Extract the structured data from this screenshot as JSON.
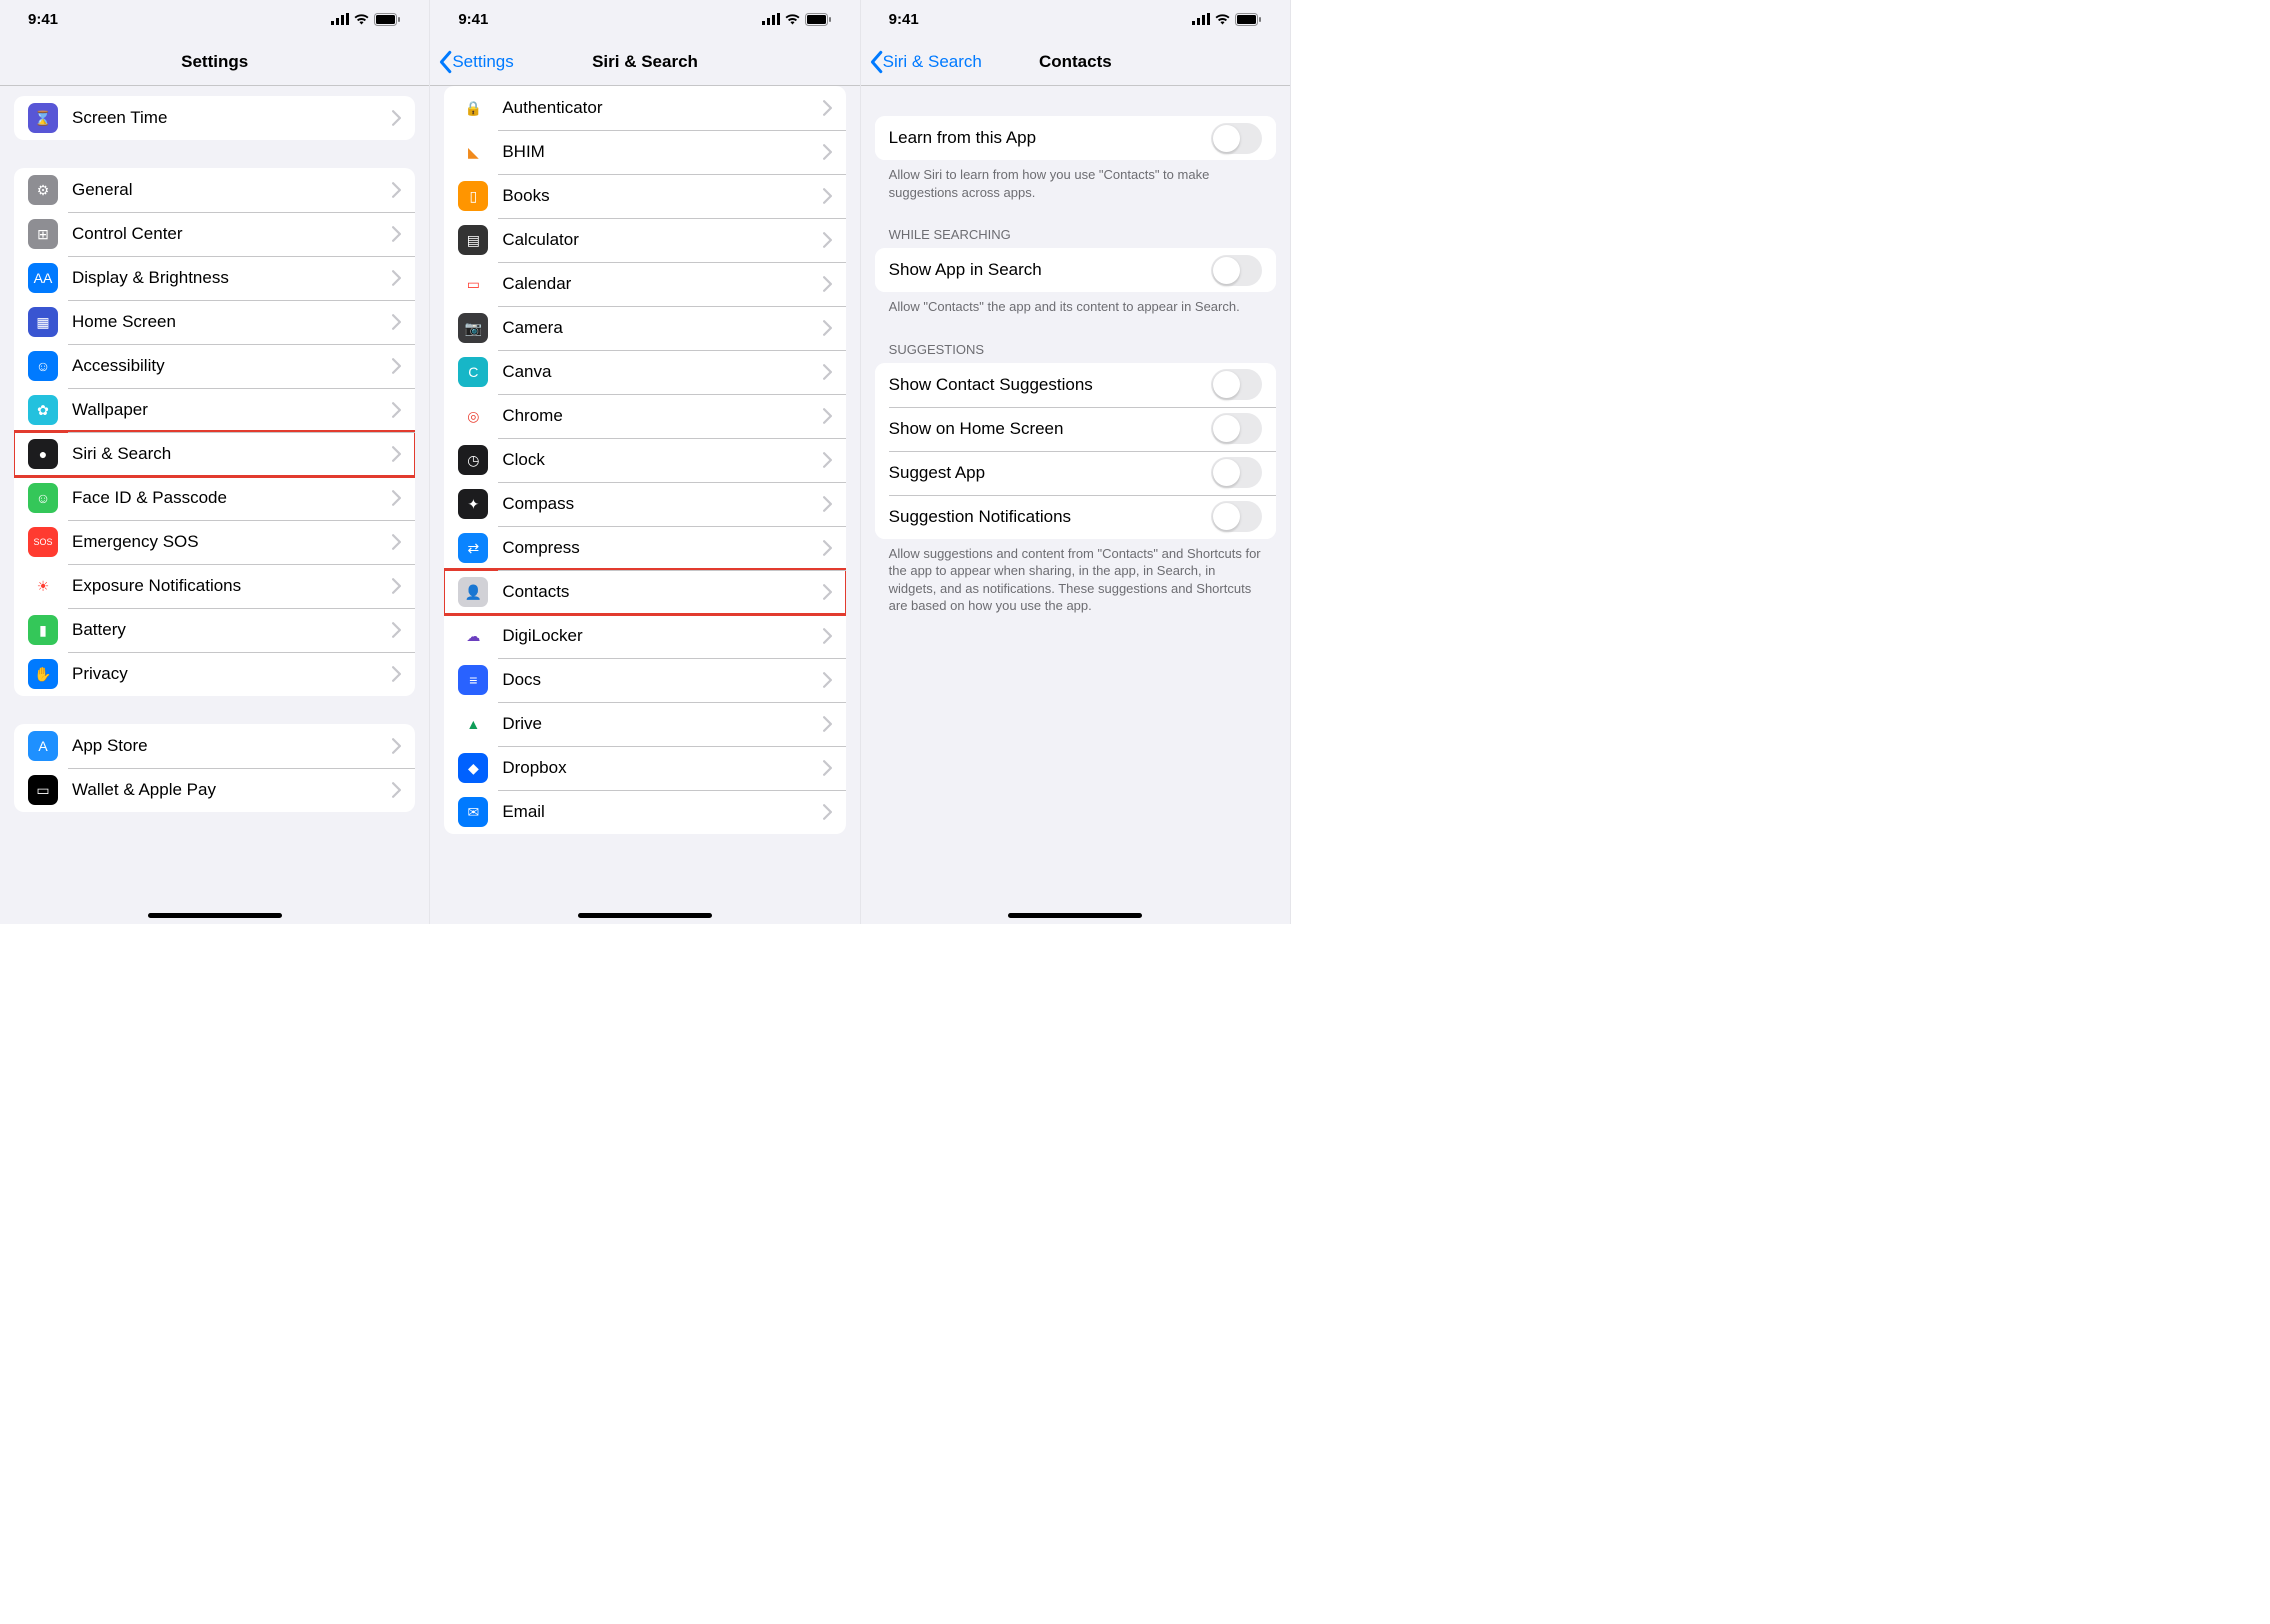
{
  "status": {
    "time": "9:41"
  },
  "screen1": {
    "title": "Settings",
    "groupA": [
      {
        "label": "Screen Time",
        "iconBg": "#5856d6",
        "glyph": "⌛"
      }
    ],
    "groupB": [
      {
        "label": "General",
        "iconBg": "#8e8e93",
        "glyph": "⚙"
      },
      {
        "label": "Control Center",
        "iconBg": "#8e8e93",
        "glyph": "⊞"
      },
      {
        "label": "Display & Brightness",
        "iconBg": "#007aff",
        "glyph": "AA"
      },
      {
        "label": "Home Screen",
        "iconBg": "#3955d1",
        "glyph": "▦"
      },
      {
        "label": "Accessibility",
        "iconBg": "#007aff",
        "glyph": "☺"
      },
      {
        "label": "Wallpaper",
        "iconBg": "#23c1de",
        "glyph": "✿"
      },
      {
        "label": "Siri & Search",
        "iconBg": "#1c1c1e",
        "glyph": "●",
        "highlight": true
      },
      {
        "label": "Face ID & Passcode",
        "iconBg": "#34c759",
        "glyph": "☺"
      },
      {
        "label": "Emergency SOS",
        "iconBg": "#ff3b30",
        "glyph": "SOS"
      },
      {
        "label": "Exposure Notifications",
        "iconBg": "#ffffff",
        "glyph": "☀",
        "fg": "#ff3b30"
      },
      {
        "label": "Battery",
        "iconBg": "#34c759",
        "glyph": "▮"
      },
      {
        "label": "Privacy",
        "iconBg": "#007aff",
        "glyph": "✋"
      }
    ],
    "groupC": [
      {
        "label": "App Store",
        "iconBg": "#1e90ff",
        "glyph": "A"
      },
      {
        "label": "Wallet & Apple Pay",
        "iconBg": "#000000",
        "glyph": "▭"
      }
    ]
  },
  "screen2": {
    "back": "Settings",
    "title": "Siri & Search",
    "apps": [
      {
        "label": "Authenticator",
        "iconBg": "#ffffff",
        "glyph": "🔒",
        "fg": "#1170d0"
      },
      {
        "label": "BHIM",
        "iconBg": "#ffffff",
        "glyph": "◣",
        "fg": "#f08a1d"
      },
      {
        "label": "Books",
        "iconBg": "#ff9500",
        "glyph": "▯"
      },
      {
        "label": "Calculator",
        "iconBg": "#333333",
        "glyph": "▤"
      },
      {
        "label": "Calendar",
        "iconBg": "#ffffff",
        "glyph": "▭",
        "fg": "#ff3b30"
      },
      {
        "label": "Camera",
        "iconBg": "#3a3a3c",
        "glyph": "📷"
      },
      {
        "label": "Canva",
        "iconBg": "#17b6c7",
        "glyph": "C"
      },
      {
        "label": "Chrome",
        "iconBg": "#ffffff",
        "glyph": "◎",
        "fg": "#ea4335"
      },
      {
        "label": "Clock",
        "iconBg": "#1c1c1e",
        "glyph": "◷"
      },
      {
        "label": "Compass",
        "iconBg": "#1c1c1e",
        "glyph": "✦"
      },
      {
        "label": "Compress",
        "iconBg": "#0a84ff",
        "glyph": "⇄"
      },
      {
        "label": "Contacts",
        "iconBg": "#d1d1d6",
        "glyph": "👤",
        "fg": "#8e8e93",
        "highlight": true
      },
      {
        "label": "DigiLocker",
        "iconBg": "#ffffff",
        "glyph": "☁",
        "fg": "#6b3fbf"
      },
      {
        "label": "Docs",
        "iconBg": "#2962ff",
        "glyph": "≡"
      },
      {
        "label": "Drive",
        "iconBg": "#ffffff",
        "glyph": "▲",
        "fg": "#0f9d58"
      },
      {
        "label": "Dropbox",
        "iconBg": "#0061ff",
        "glyph": "◆"
      },
      {
        "label": "Email",
        "iconBg": "#007aff",
        "glyph": "✉"
      }
    ]
  },
  "screen3": {
    "back": "Siri & Search",
    "title": "Contacts",
    "learn": {
      "label": "Learn from this App"
    },
    "learnFooter": "Allow Siri to learn from how you use \"Contacts\" to make suggestions across apps.",
    "searchHeader": "WHILE SEARCHING",
    "search": {
      "label": "Show App in Search"
    },
    "searchFooter": "Allow \"Contacts\" the app and its content to appear in Search.",
    "suggHeader": "SUGGESTIONS",
    "sugg": [
      {
        "label": "Show Contact Suggestions"
      },
      {
        "label": "Show on Home Screen"
      },
      {
        "label": "Suggest App"
      },
      {
        "label": "Suggestion Notifications"
      }
    ],
    "suggFooter": "Allow suggestions and content from \"Contacts\" and Shortcuts for the app to appear when sharing, in the app, in Search, in widgets, and as notifications. These suggestions and Shortcuts are based on how you use the app."
  }
}
